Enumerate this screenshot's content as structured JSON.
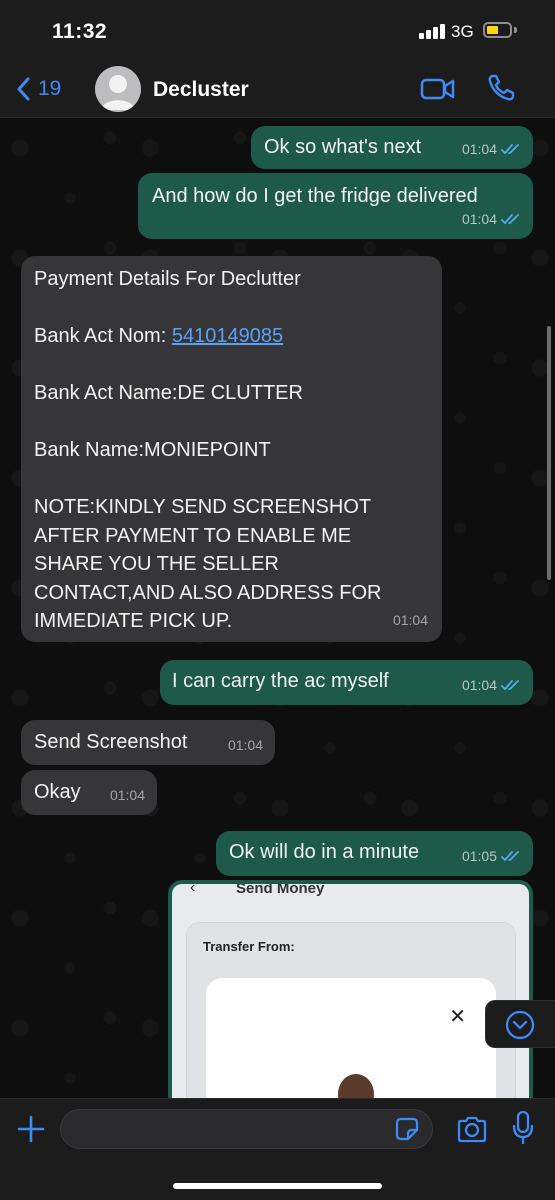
{
  "status_bar": {
    "time": "11:32",
    "network": "3G"
  },
  "header": {
    "back_count": "19",
    "contact_name": "Decluster"
  },
  "messages": [
    {
      "text": "Ok so what's next",
      "time": "01:04"
    },
    {
      "text": "And how do I get the fridge delivered",
      "time": "01:04"
    },
    {
      "lines": [
        "Payment Details For Declutter",
        "",
        "Bank Act Nom: ",
        "",
        "Bank  Act Name:DE CLUTTER",
        "",
        "Bank Name:MONIEPOINT",
        "",
        "NOTE:KINDLY SEND SCREENSHOT",
        "AFTER PAYMENT TO ENABLE ME",
        "SHARE YOU THE SELLER",
        "CONTACT,AND ALSO ADDRESS FOR",
        "IMMEDIATE PICK UP."
      ],
      "account_number": "5410149085",
      "time": "01:04"
    },
    {
      "text": "I can carry the ac myself",
      "time": "01:04"
    },
    {
      "text": "Send Screenshot",
      "time": "01:04"
    },
    {
      "text": "Okay",
      "time": "01:04"
    },
    {
      "text": "Ok will do in a minute",
      "time": "01:05"
    }
  ],
  "image_message": {
    "screen_title": "Send Money",
    "transfer_label": "Transfer From:",
    "close_glyph": "✕",
    "back_glyph": "‹"
  },
  "input": {
    "placeholder": ""
  },
  "colors": {
    "outgoing": "#1e5a49",
    "incoming": "#363638",
    "accent": "#3d8bf7",
    "read_ticks": "#53a8f0"
  }
}
